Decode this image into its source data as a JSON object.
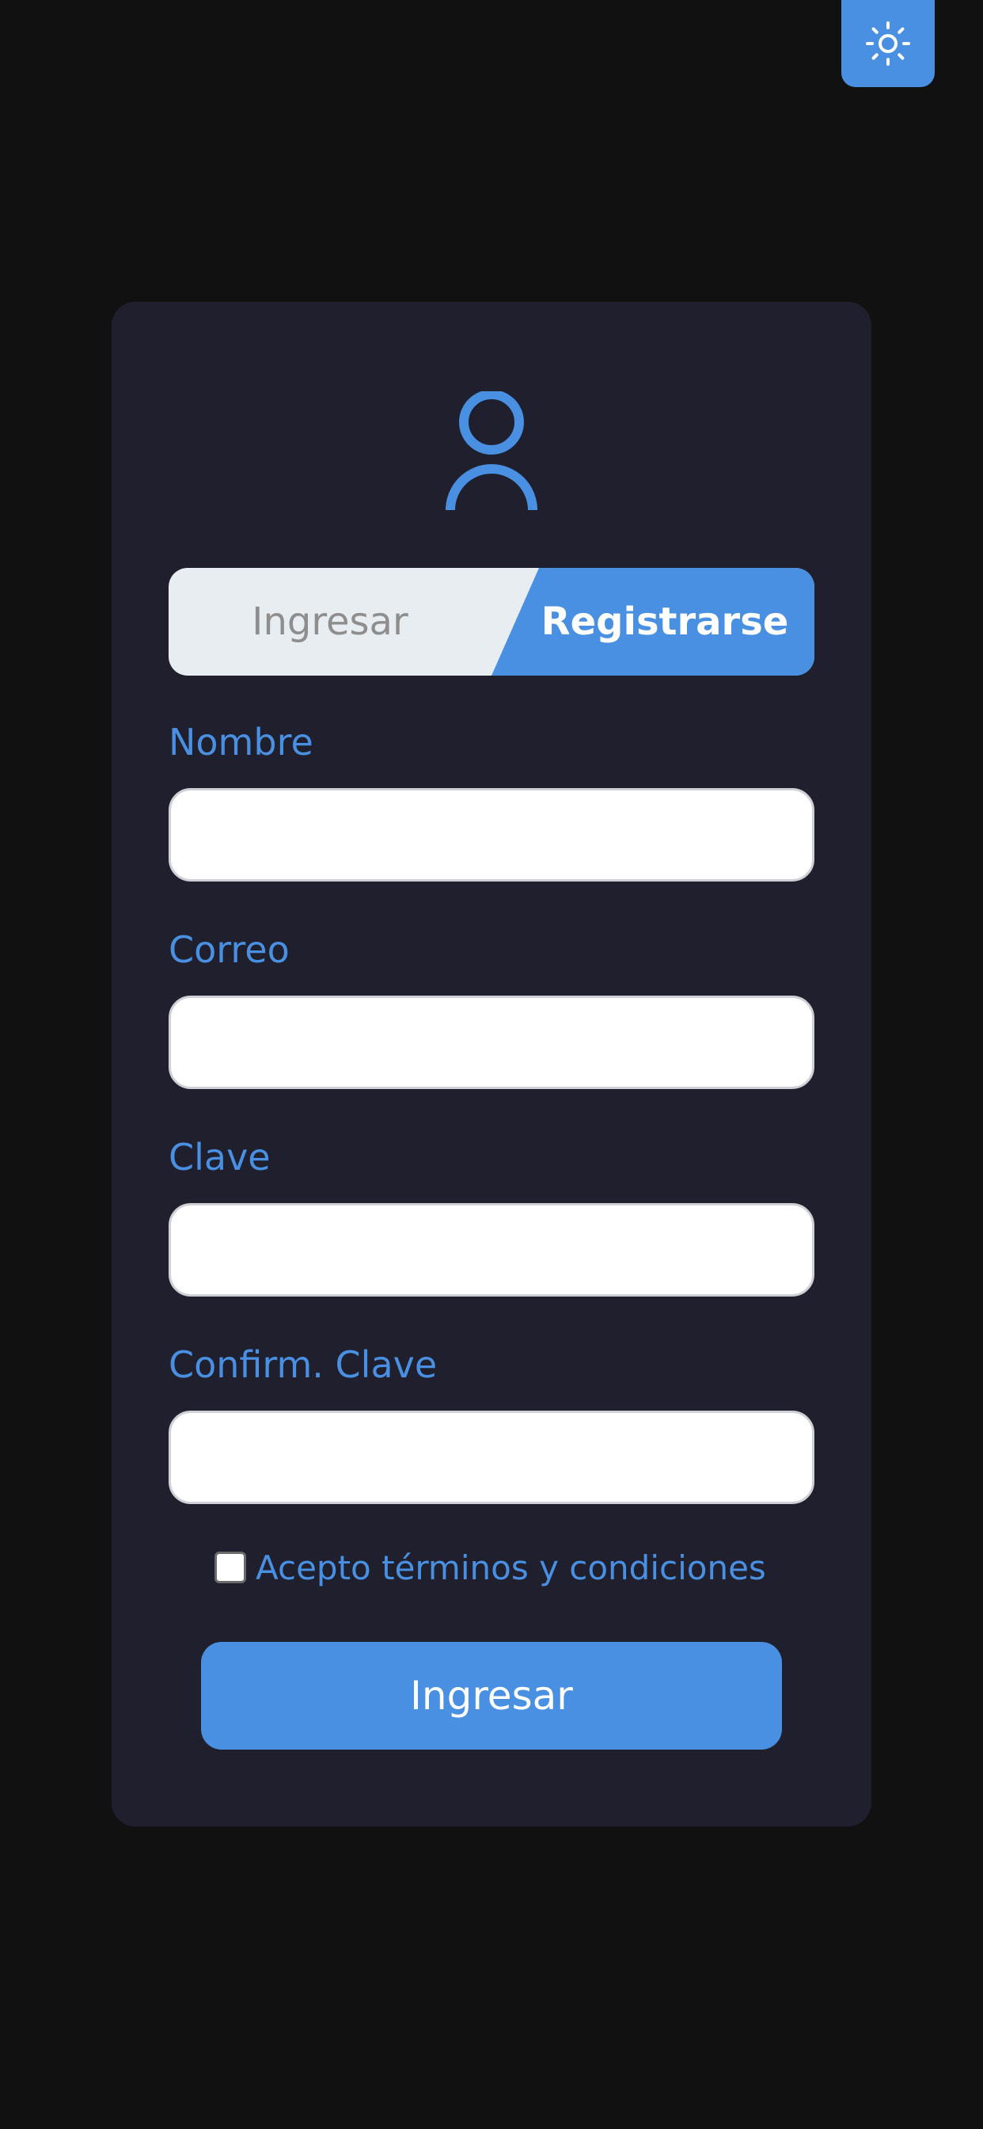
{
  "theme_toggle": {
    "icon": "sun-icon"
  },
  "avatar": {
    "icon": "user-icon"
  },
  "tabs": {
    "login_label": "Ingresar",
    "register_label": "Registrarse",
    "active": "register"
  },
  "form": {
    "fields": [
      {
        "label": "Nombre",
        "value": ""
      },
      {
        "label": "Correo",
        "value": ""
      },
      {
        "label": "Clave",
        "value": ""
      },
      {
        "label": "Confirm. Clave",
        "value": ""
      }
    ],
    "terms_label": "Acepto términos y condiciones",
    "terms_checked": false,
    "submit_label": "Ingresar"
  },
  "colors": {
    "background": "#111111",
    "card": "#1f1f2e",
    "accent": "#4a90e2",
    "tab_inactive_bg": "#e8edf1",
    "tab_inactive_text": "#8e8e8e"
  }
}
